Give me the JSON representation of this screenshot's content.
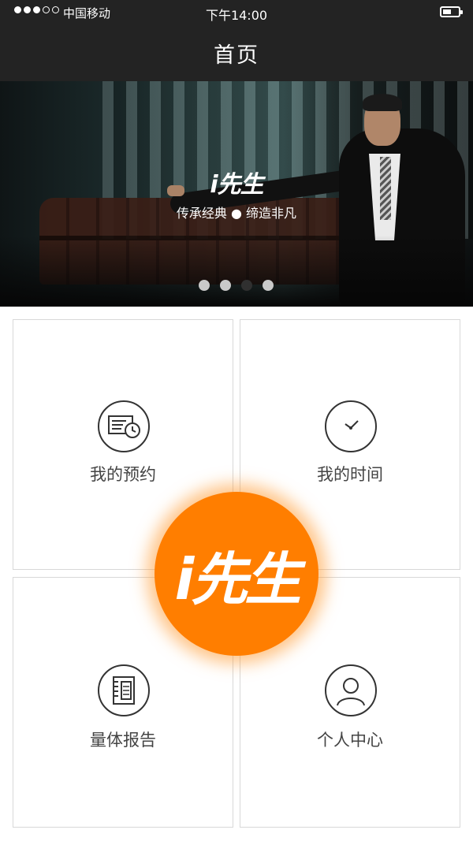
{
  "status_bar": {
    "carrier": "中国移动",
    "time": "下午14:00"
  },
  "nav": {
    "title": "首页"
  },
  "banner": {
    "brand": "i先生",
    "slogan": "传承经典 ● 缔造非凡",
    "slides": 4,
    "active_slide": 3
  },
  "grid": {
    "items": [
      {
        "label": "我的预约",
        "icon": "appointment-icon"
      },
      {
        "label": "我的时间",
        "icon": "clock-icon"
      },
      {
        "label": "量体报告",
        "icon": "report-icon"
      },
      {
        "label": "个人中心",
        "icon": "user-icon"
      }
    ]
  },
  "logo": {
    "text": "i先生",
    "color": "#ff7e00"
  }
}
